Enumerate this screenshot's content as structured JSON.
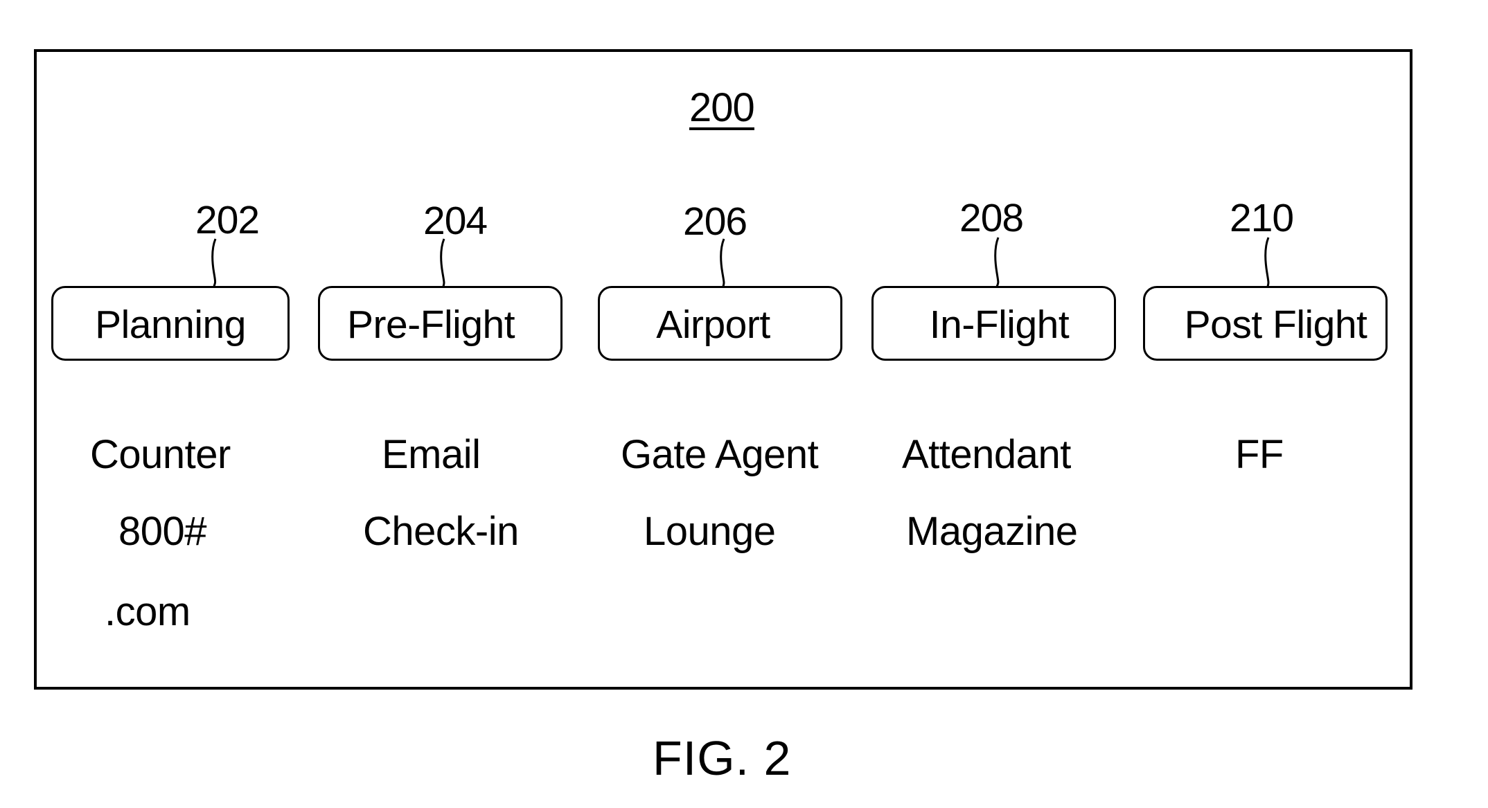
{
  "diagram": {
    "reference_number": "200",
    "caption": "FIG. 2",
    "stages": [
      {
        "ref": "202",
        "label": "Planning",
        "touchpoints": [
          "Counter",
          "800#",
          ".com"
        ]
      },
      {
        "ref": "204",
        "label": "Pre-Flight",
        "touchpoints": [
          "Email",
          "Check-in"
        ]
      },
      {
        "ref": "206",
        "label": "Airport",
        "touchpoints": [
          "Gate Agent",
          "Lounge"
        ]
      },
      {
        "ref": "208",
        "label": "In-Flight",
        "touchpoints": [
          "Attendant",
          "Magazine"
        ]
      },
      {
        "ref": "210",
        "label": "Post Flight",
        "touchpoints": [
          "FF"
        ]
      }
    ]
  }
}
